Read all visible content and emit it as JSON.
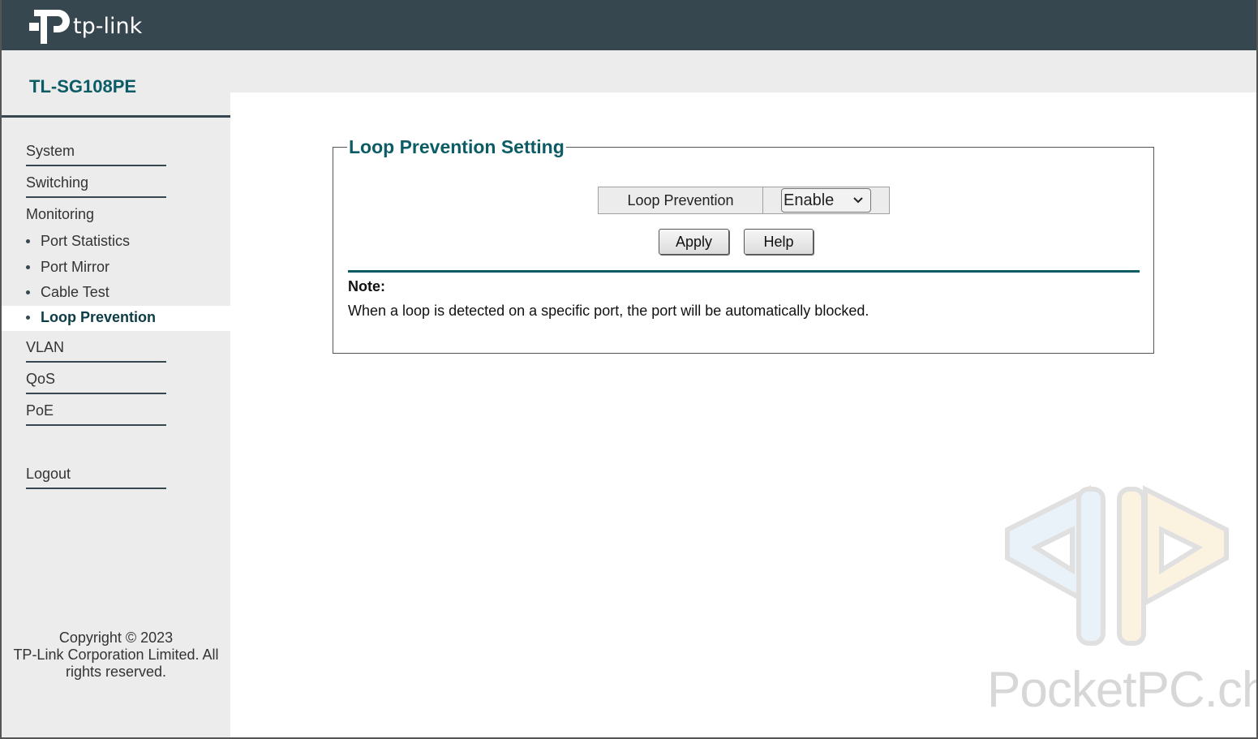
{
  "brand": {
    "logo_text": "tp-link"
  },
  "device": {
    "model": "TL-SG108PE"
  },
  "sidebar": {
    "system": "System",
    "switching": "Switching",
    "monitoring": "Monitoring",
    "monitoring_items": [
      "Port Statistics",
      "Port Mirror",
      "Cable Test",
      "Loop Prevention"
    ],
    "active_item": "Loop Prevention",
    "vlan": "VLAN",
    "qos": "QoS",
    "poe": "PoE",
    "logout": "Logout",
    "copyright_line1": "Copyright © 2023",
    "copyright_line2": "TP-Link Corporation Limited. All",
    "copyright_line3": "rights reserved."
  },
  "main": {
    "section_title": "Loop Prevention Setting",
    "setting_label": "Loop Prevention",
    "setting_value": "Enable",
    "apply_label": "Apply",
    "help_label": "Help",
    "note_title": "Note:",
    "note_text": "When a loop is detected on a specific port, the port will be automatically blocked."
  },
  "watermark": {
    "text": "PocketPC.ch"
  },
  "colors": {
    "header": "#37474f",
    "accent": "#0c5c66",
    "sidebar_bg": "#ececec"
  },
  "icons": {
    "logo": "tp-link-logo-icon",
    "dropdown": "chevron-down-icon",
    "bullet": "bullet-icon",
    "watermark": "pocketpc-logo-icon"
  }
}
